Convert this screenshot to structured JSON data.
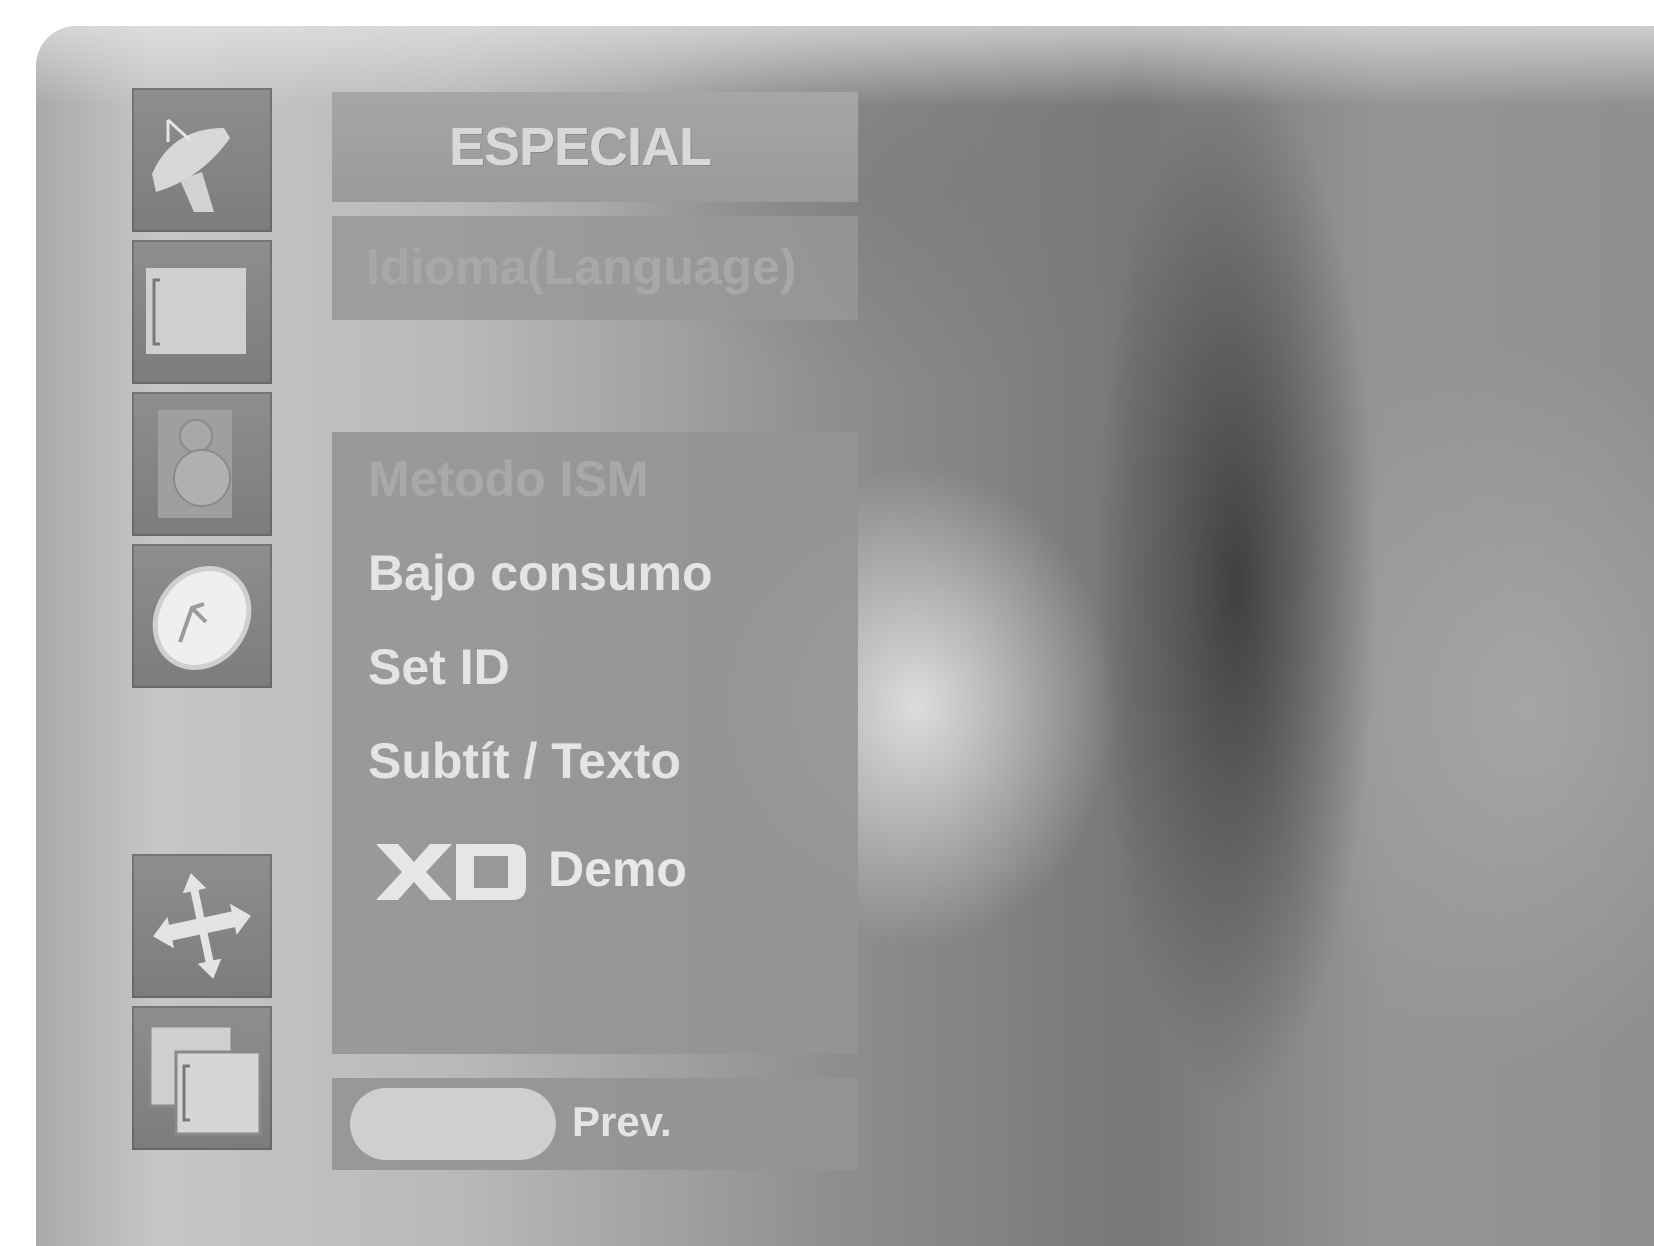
{
  "menu": {
    "title": "ESPECIAL",
    "language_item": "Idioma(Language)",
    "items": [
      {
        "label": "Metodo ISM",
        "state": "dimmed"
      },
      {
        "label": "Bajo consumo",
        "state": "normal"
      },
      {
        "label": "Set ID",
        "state": "normal"
      },
      {
        "label": "Subtít / Texto",
        "state": "normal"
      }
    ],
    "demo": {
      "logo": "XD",
      "label": "Demo"
    },
    "footer": {
      "prev_label": "Prev."
    }
  },
  "sidebar": {
    "icons": [
      "satellite-dish-icon",
      "screen-picture-icon",
      "speaker-sound-icon",
      "clock-time-icon",
      "cross-arrows-special-icon",
      "overlapping-screens-screen-icon"
    ]
  }
}
